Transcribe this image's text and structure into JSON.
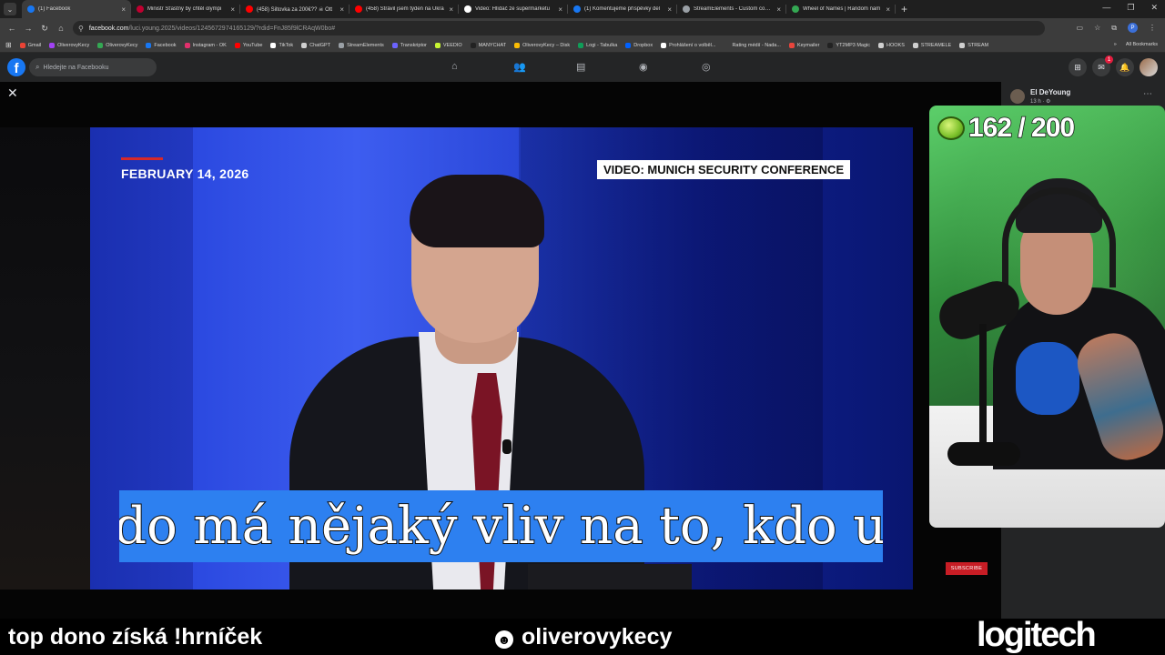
{
  "browser": {
    "tabs": [
      {
        "title": "(1) Facebook",
        "color": "#1877f2",
        "active": true
      },
      {
        "title": "Ministr Šťastný by chtěl olympi",
        "color": "#c00030",
        "active": false
      },
      {
        "title": "(458) Šiltovka za 200€?? ☠ Ott",
        "color": "#ff0000",
        "active": false
      },
      {
        "title": "(458) Strávil jsem týden na Ukra",
        "color": "#ff0000",
        "active": false
      },
      {
        "title": "Video: Hlídač ze supermarketu",
        "color": "#ffffff",
        "active": false
      },
      {
        "title": "(1) Komentujeme příspěvky del",
        "color": "#1877f2",
        "active": false
      },
      {
        "title": "StreamElements - Custom comm",
        "color": "#9aa0a6",
        "active": false
      },
      {
        "title": "Wheel of Names | Random nam",
        "color": "#34a853",
        "active": false
      }
    ],
    "address": {
      "host": "facebook.com",
      "path": "/luci.young.2025/videos/1245672974165129/?rdid=FnJ85f9lCRAqW0bo#"
    },
    "bookmarks": [
      {
        "label": "Gmail",
        "color": "#ea4335"
      },
      {
        "label": "OliverovyKecy",
        "color": "#a142f4"
      },
      {
        "label": "OliverovyKecy",
        "color": "#34a853"
      },
      {
        "label": "Facebook",
        "color": "#1877f2"
      },
      {
        "label": "Instagram - OK",
        "color": "#e1306c"
      },
      {
        "label": "YouTube",
        "color": "#ff0000"
      },
      {
        "label": "TikTok",
        "color": "#ffffff"
      },
      {
        "label": "ChatGPT",
        "color": "#cfcfcf"
      },
      {
        "label": "StreamElements",
        "color": "#9aa0a6"
      },
      {
        "label": "Transkriptor",
        "color": "#6c63ff"
      },
      {
        "label": "VEEDIO",
        "color": "#c6f432"
      },
      {
        "label": "MANYCHAT",
        "color": "#222222"
      },
      {
        "label": "OliverovyKecy – Disk",
        "color": "#fbbc04"
      },
      {
        "label": "Logi - Tabulka",
        "color": "#0f9d58"
      },
      {
        "label": "Dropbox",
        "color": "#0061ff"
      },
      {
        "label": "Prohlášení o volběl...",
        "color": "#ffffff"
      },
      {
        "label": "Rating médií - Nada...",
        "color": "#3c3c3c"
      },
      {
        "label": "Keymailer",
        "color": "#e8453c"
      },
      {
        "label": "YT2MP3 Magic",
        "color": "#222222"
      },
      {
        "label": "HOOKS",
        "color": "#cfcfcf"
      },
      {
        "label": "STREAMELE",
        "color": "#cfcfcf"
      },
      {
        "label": "STREAM",
        "color": "#cfcfcf"
      }
    ],
    "all_bookmarks": "All Bookmarks",
    "profile_initial": "P"
  },
  "facebook": {
    "search_placeholder": "Hledejte na Facebooku",
    "notification_count": "1",
    "post": {
      "author": "El DeYoung",
      "time": "13 h · ⚙"
    }
  },
  "video": {
    "date": "FEBRUARY 14, 2026",
    "label": "VIDEO: MUNICH SECURITY CONFERENCE",
    "subtitle": "kdo má nějaký vliv na to, kdo uh",
    "subscribe": "SUBSCRIBE"
  },
  "stream_overlay": {
    "counter": "162 / 200",
    "promo": "top dono získá !hrníček",
    "channel": "oliverovykecy",
    "sponsor": "logitech"
  },
  "colors": {
    "facebook_blue": "#1877f2",
    "subtitle_bg": "#2d80f0",
    "browser_chrome": "#3c3c3c"
  }
}
